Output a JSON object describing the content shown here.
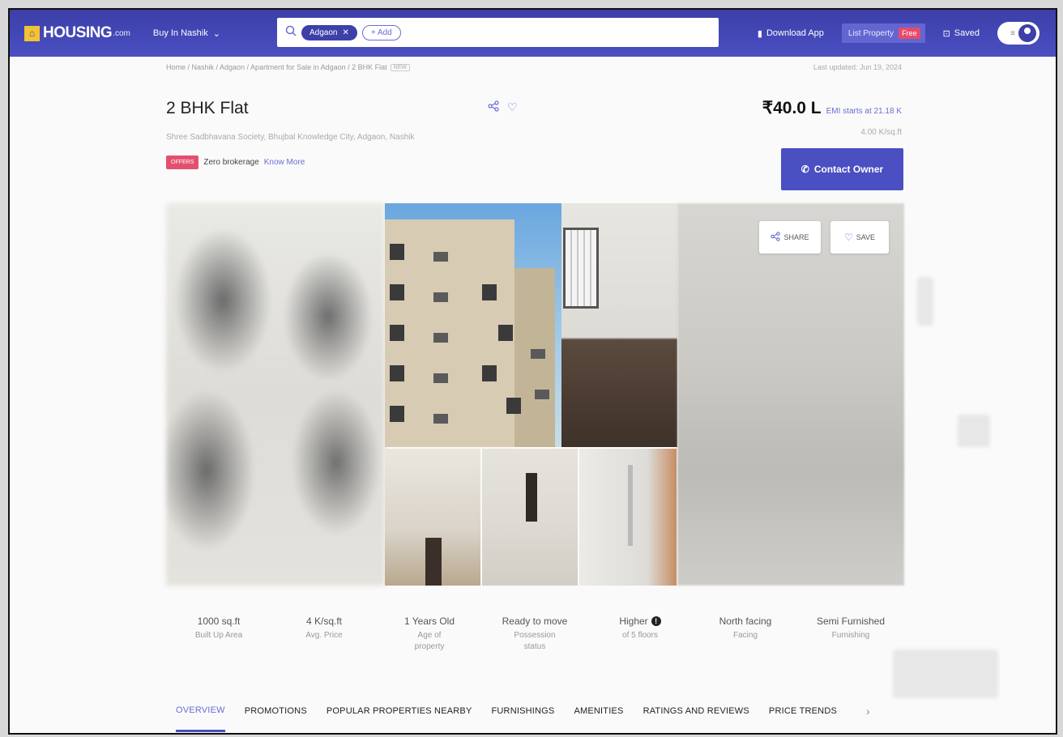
{
  "nav": {
    "logo_text": "HOUSING",
    "logo_suffix": ".com",
    "city_button": "Buy In Nashik",
    "search_chip": "Adgaon",
    "add_chip": "+ Add",
    "download_app": "Download App",
    "list_property": "List Property",
    "free_badge": "Free",
    "saved": "Saved"
  },
  "breadcrumb": {
    "path": "Home / Nashik / Adgaon / Apartment for Sale in Adgaon / 2 BHK Flat",
    "tag": "NEW",
    "last_updated": "Last updated: Jun 19, 2024"
  },
  "listing": {
    "title": "2 BHK Flat",
    "address": "Shree Sadbhavana Society, Bhujbal Knowledge City, Adgaon, Nashik",
    "offers_badge": "OFFERS",
    "offer_text": "Zero brokerage",
    "know_more": "Know More",
    "price": "₹40.0 L",
    "emi": "EMI starts at  21.18 K",
    "per_sqft": "4.00 K/sq.ft",
    "contact_button": "Contact Owner"
  },
  "gallery": {
    "share": "SHARE",
    "save": "SAVE"
  },
  "stats": [
    {
      "value": "1000 sq.ft",
      "label": "Built Up Area"
    },
    {
      "value": "4 K/sq.ft",
      "label": "Avg. Price"
    },
    {
      "value": "1 Years Old",
      "label": "Age of property"
    },
    {
      "value": "Ready to move",
      "label": "Possession status"
    },
    {
      "value": "Higher",
      "label": "of 5 floors"
    },
    {
      "value": "North facing",
      "label": "Facing"
    },
    {
      "value": "Semi Furnished",
      "label": "Furnishing"
    }
  ],
  "tabs": [
    {
      "label": "OVERVIEW",
      "active": true
    },
    {
      "label": "PROMOTIONS"
    },
    {
      "label": "POPULAR PROPERTIES NEARBY"
    },
    {
      "label": "FURNISHINGS"
    },
    {
      "label": "AMENITIES"
    },
    {
      "label": "RATINGS AND REVIEWS"
    },
    {
      "label": "PRICE TRENDS"
    }
  ],
  "colors": {
    "brand": "#4a4fc2",
    "accent": "#6a6dd4",
    "offer": "#e3506f",
    "logo_yellow": "#f3c233"
  },
  "icons": [
    "home-logo-icon",
    "chevron-down-icon",
    "search-icon",
    "close-icon",
    "phone-download-icon",
    "bookmark-icon",
    "menu-icon",
    "user-icon",
    "share-icon",
    "heart-icon",
    "phone-icon",
    "info-icon",
    "chevron-right-icon"
  ]
}
